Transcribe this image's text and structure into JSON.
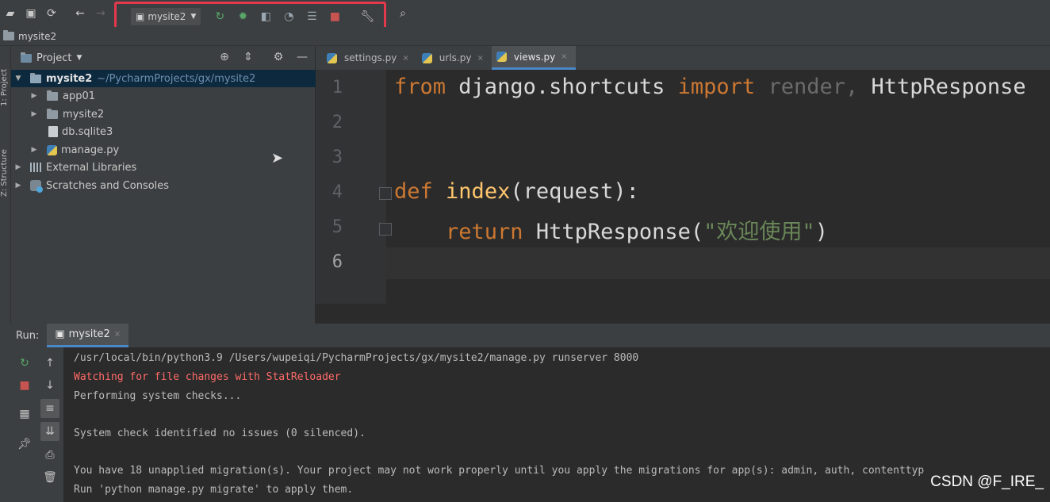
{
  "toolbar": {
    "run_config": "mysite2"
  },
  "breadcrumb": {
    "project": "mysite2"
  },
  "sidebar_stripe": {
    "project_label": "1: Project",
    "structure_label": "Z: Structure"
  },
  "project_panel": {
    "title": "Project",
    "tree": [
      {
        "label": "mysite2",
        "path": "~/PycharmProjects/gx/mysite2"
      },
      {
        "label": "app01"
      },
      {
        "label": "mysite2"
      },
      {
        "label": "db.sqlite3"
      },
      {
        "label": "manage.py"
      },
      {
        "label": "External Libraries"
      },
      {
        "label": "Scratches and Consoles"
      }
    ]
  },
  "editor": {
    "tabs": [
      {
        "label": "settings.py"
      },
      {
        "label": "urls.py"
      },
      {
        "label": "views.py"
      }
    ],
    "line_numbers": [
      "1",
      "2",
      "3",
      "4",
      "5",
      "6"
    ],
    "code": {
      "l1_from": "from",
      "l1_module": "django.shortcuts",
      "l1_import": "import",
      "l1_render": "render,",
      "l1_http": "HttpResponse",
      "l4_def": "def",
      "l4_name": "index",
      "l4_args": "(request):",
      "l5_return": "return",
      "l5_call": "HttpResponse(",
      "l5_string": "\"欢迎使用\"",
      "l5_close": ")"
    }
  },
  "run_window": {
    "label": "Run:",
    "tab": "mysite2",
    "console": [
      "/usr/local/bin/python3.9 /Users/wupeiqi/PycharmProjects/gx/mysite2/manage.py runserver 8000",
      "Watching for file changes with StatReloader",
      "Performing system checks...",
      "",
      "System check identified no issues (0 silenced).",
      "",
      "You have 18 unapplied migration(s). Your project may not work properly until you apply the migrations for app(s): admin, auth, contenttyp",
      "Run 'python manage.py migrate' to apply them."
    ]
  },
  "watermark": "CSDN @F_IRE_",
  "colors": {
    "highlight_border": "#e4384d",
    "keyword": "#cc7832",
    "function": "#ffc66d",
    "string": "#6a8759",
    "console_error": "#ff6b68"
  }
}
